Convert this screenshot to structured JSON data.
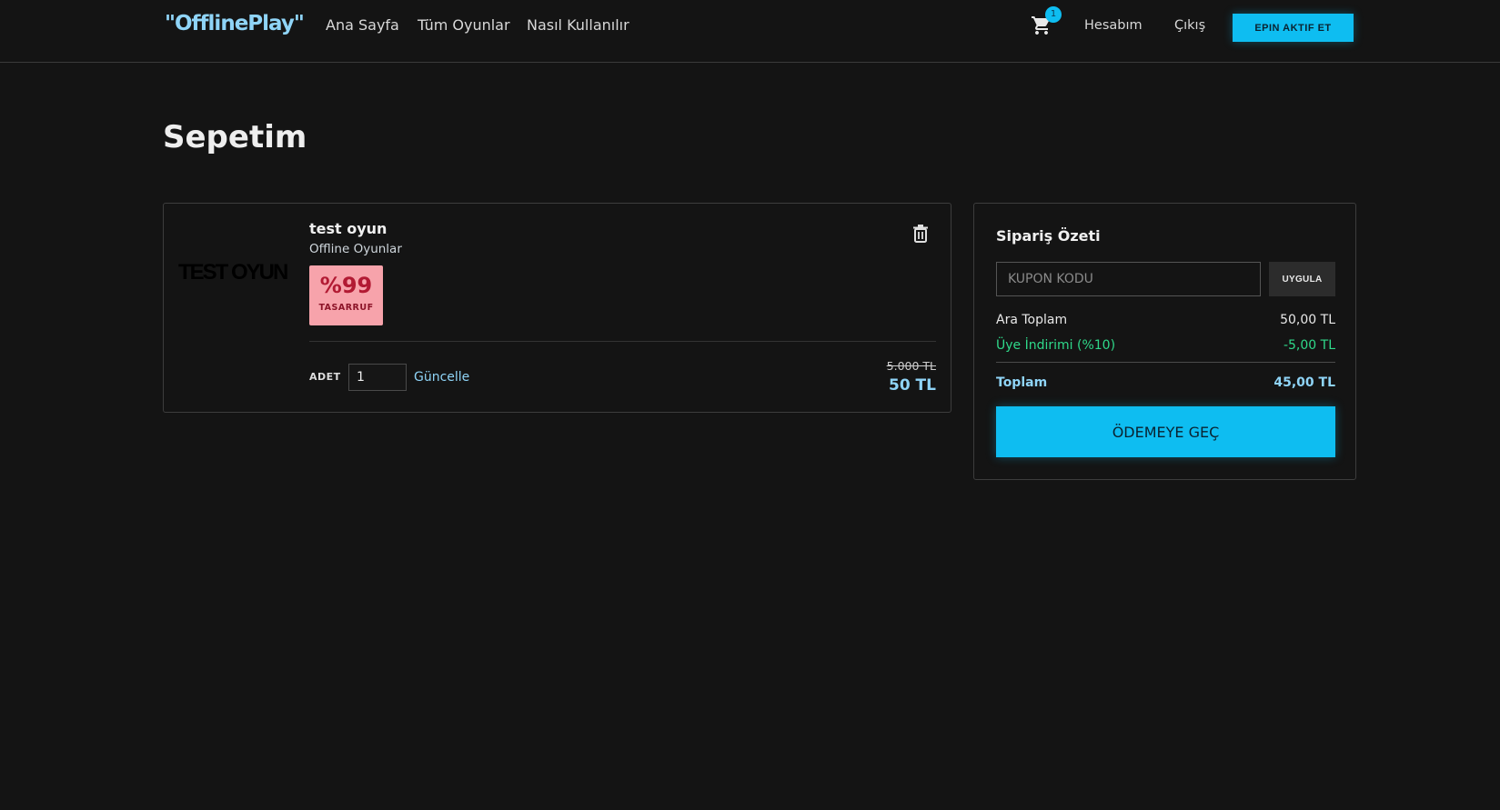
{
  "header": {
    "logo": "\"OfflinePlay\"",
    "nav": [
      "Ana Sayfa",
      "Tüm Oyunlar",
      "Nasıl Kullanılır"
    ],
    "cart_count": "1",
    "account": "Hesabım",
    "logout": "Çıkış",
    "epin_button": "EPIN AKTIF ET"
  },
  "page_title": "Sepetim",
  "cart_item": {
    "thumbnail_text": "TEST OYUN",
    "name": "test oyun",
    "category": "Offline Oyunlar",
    "discount_percent": "%99",
    "discount_label": "TASARRUF",
    "qty_label": "ADET",
    "qty_value": "1",
    "update_link": "Güncelle",
    "old_price": "5.000 TL",
    "new_price": "50 TL"
  },
  "summary": {
    "title": "Sipariş Özeti",
    "coupon_placeholder": "KUPON KODU",
    "apply_button": "UYGULA",
    "subtotal_label": "Ara Toplam",
    "subtotal_value": "50,00 TL",
    "discount_label": "Üye İndirimi (%10)",
    "discount_value": "-5,00 TL",
    "total_label": "Toplam",
    "total_value": "45,00 TL",
    "checkout_button": "ÖDEMEYE GEÇ"
  },
  "colors": {
    "background": "#141414",
    "accent": "#0ebdf1",
    "link": "#8fd4f7",
    "discount_green": "#2fd98a",
    "badge_pink": "#f7a3ab"
  },
  "icons": [
    "cart-icon",
    "trash-icon"
  ]
}
